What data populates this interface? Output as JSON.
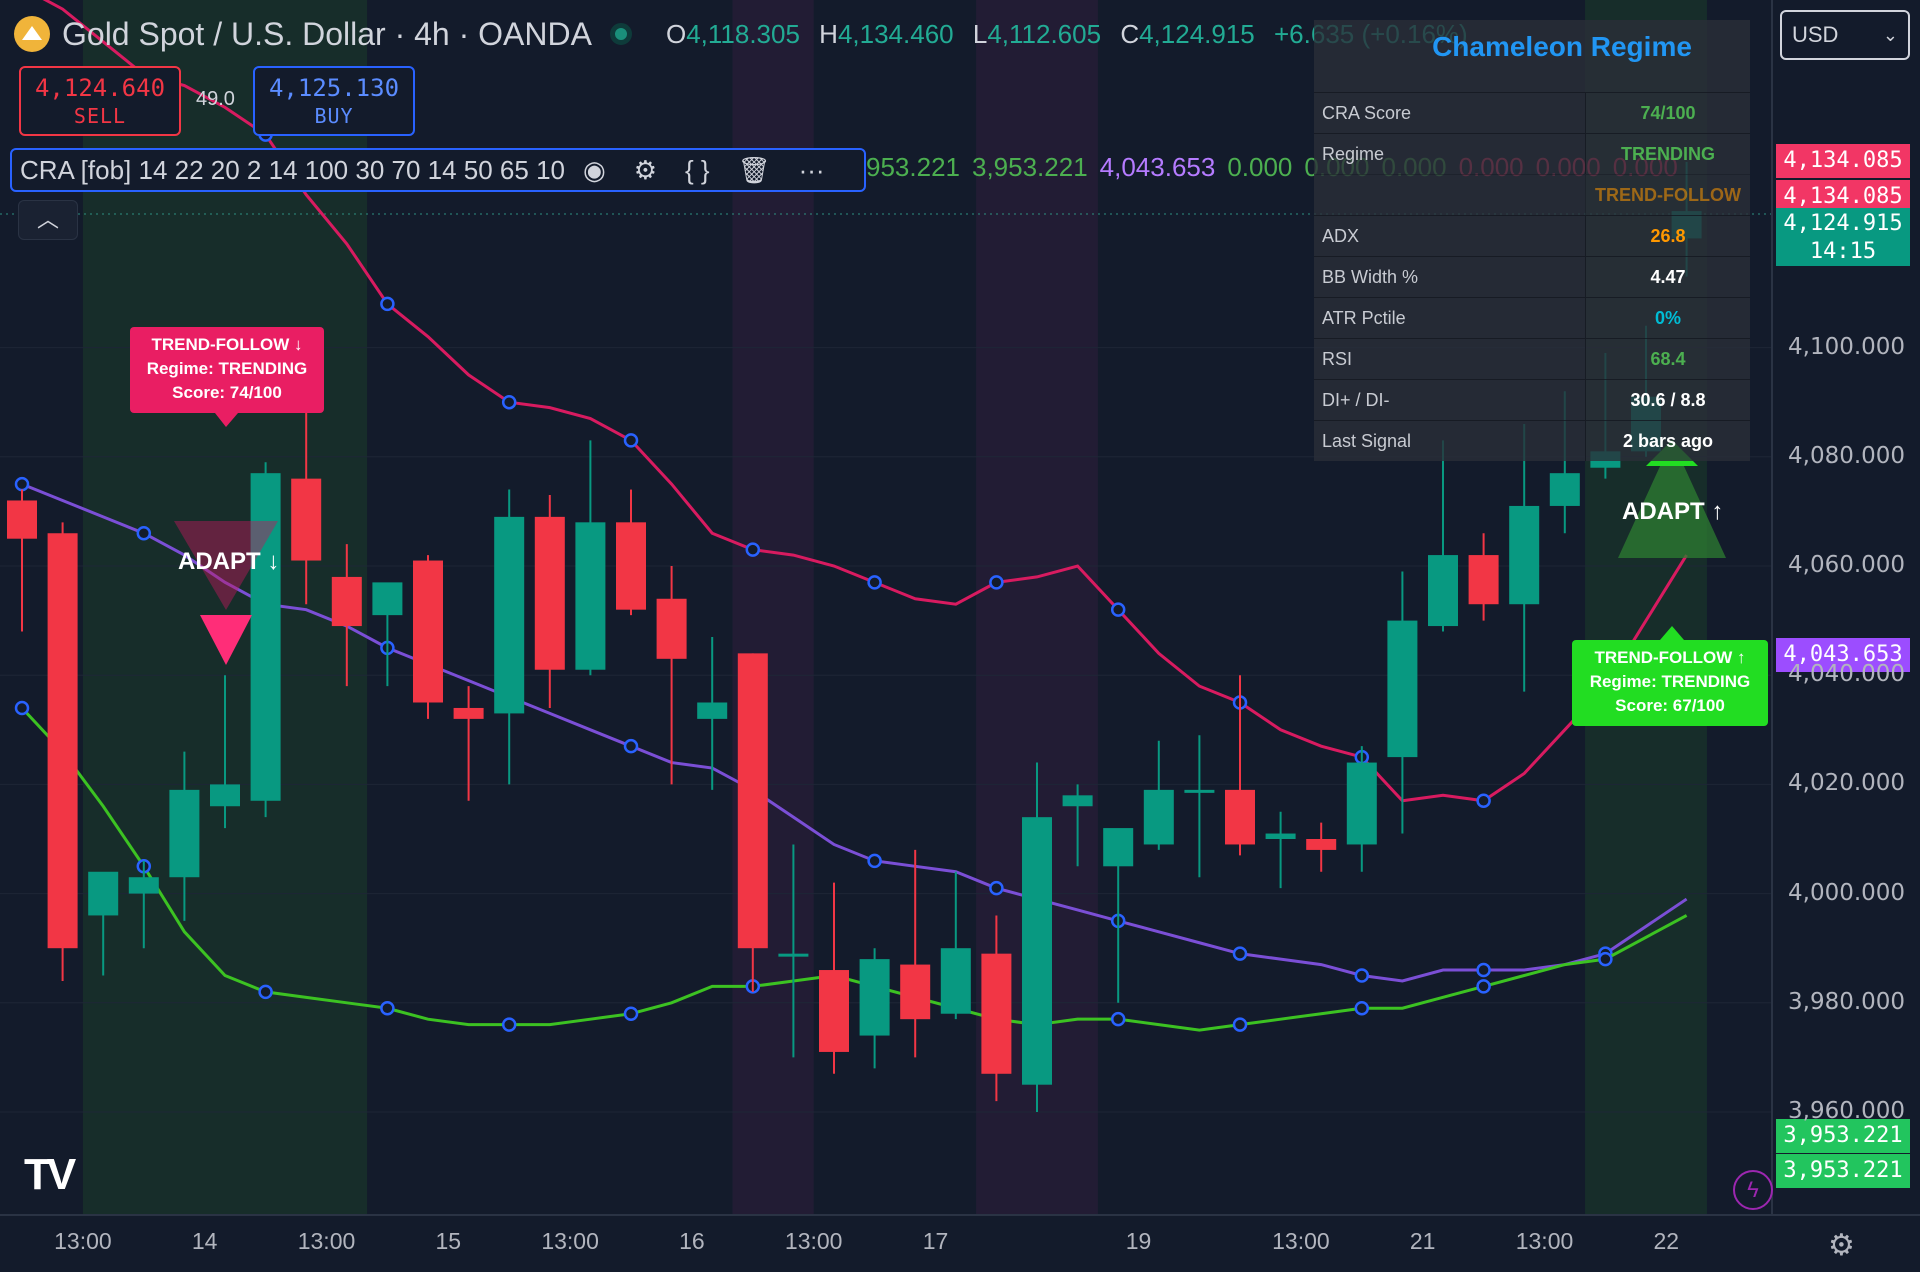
{
  "header": {
    "symbol": "Gold Spot / U.S. Dollar · 4h · OANDA",
    "o_label": "O",
    "o": "4,118.305",
    "h_label": "H",
    "h": "4,134.460",
    "l_label": "L",
    "l": "4,112.605",
    "c_label": "C",
    "c": "4,124.915",
    "change": "+6.635 (+0.16%)"
  },
  "trade": {
    "sell_price": "4,124.640",
    "sell_label": "SELL",
    "spread": "49.0",
    "buy_price": "4,125.130",
    "buy_label": "BUY"
  },
  "indicator": {
    "name": "CRA [fob] 14 22 20 2 14 100 30 70 14 50 65 10",
    "values": [
      {
        "text": "953.221",
        "color": "#4caf50"
      },
      {
        "text": "3,953.221",
        "color": "#4caf50"
      },
      {
        "text": "4,043.653",
        "color": "#b57bff"
      },
      {
        "text": "0.000",
        "color": "#4caf50"
      },
      {
        "text": "0.000",
        "color": "#4caf50"
      },
      {
        "text": "0.000",
        "color": "#4caf50"
      },
      {
        "text": "0.000",
        "color": "#f23665"
      },
      {
        "text": "0.000",
        "color": "#f23665"
      },
      {
        "text": "0.000",
        "color": "#f23665"
      }
    ],
    "eye_icon": "eye-icon",
    "settings_icon": "settings-icon",
    "code_icon": "code-icon",
    "delete_icon": "trash-icon",
    "more_icon": "more-icon"
  },
  "currency": "USD",
  "panel": {
    "title": "Chameleon Regime",
    "rows": [
      {
        "key": "CRA Score",
        "value": "74/100",
        "color": "#4caf50"
      },
      {
        "key": "Regime",
        "value": "TRENDING",
        "color": "#4caf50"
      },
      {
        "key": "",
        "value": "TREND-FOLLOW",
        "color": "#ff9800"
      },
      {
        "key": "ADX",
        "value": "26.8",
        "color": "#ff9800"
      },
      {
        "key": "BB Width %",
        "value": "4.47",
        "color": "#ffffff"
      },
      {
        "key": "ATR Pctile",
        "value": "0%",
        "color": "#00bcd4"
      },
      {
        "key": "RSI",
        "value": "68.4",
        "color": "#4caf50"
      },
      {
        "key": "DI+ / DI-",
        "value": "30.6 / 8.8",
        "color": "#ffffff"
      },
      {
        "key": "Last Signal",
        "value": "2 bars ago",
        "color": "#ffffff"
      }
    ]
  },
  "labels": {
    "sell_signal": {
      "line1": "TREND-FOLLOW ↓",
      "line2": "Regime: TRENDING",
      "line3": "Score: 74/100"
    },
    "buy_signal": {
      "line1": "TREND-FOLLOW ↑",
      "line2": "Regime: TRENDING",
      "line3": "Score: 67/100"
    },
    "adapt_down": "ADAPT ↓",
    "adapt_up": "ADAPT ↑"
  },
  "price_tags": [
    {
      "text": "4,134.085",
      "color": "#f23665",
      "price": 4134.085
    },
    {
      "text": "4,134.085",
      "color": "#f23665",
      "price": 4127.6
    },
    {
      "text": "4,124.915",
      "color": "#089981",
      "price": 4121.0,
      "sub": "14:15"
    },
    {
      "text": "4,043.653",
      "color": "#9c4dff",
      "price": 4043.653
    },
    {
      "text": "3,953.221",
      "color": "#22c55e",
      "price": 3955.6
    },
    {
      "text": "3,953.221",
      "color": "#22c55e",
      "price": 3949.2
    }
  ],
  "chart_data": {
    "type": "candlestick",
    "symbol": "XAUUSD",
    "timeframe": "4h",
    "ylim": [
      3937,
      4157
    ],
    "y_ticks": [
      4100,
      4080,
      4060,
      4040,
      4020,
      4000,
      3980,
      3960
    ],
    "y_tick_labels": [
      "4,100.000",
      "4,080.000",
      "4,060.000",
      "4,040.000",
      "4,020.000",
      "4,000.000",
      "3,980.000",
      "3,960.000"
    ],
    "x_ticks": [
      {
        "label": "13:00",
        "bar": 1.5
      },
      {
        "label": "14",
        "bar": 4.5
      },
      {
        "label": "13:00",
        "bar": 7.5
      },
      {
        "label": "15",
        "bar": 10.5
      },
      {
        "label": "13:00",
        "bar": 13.5
      },
      {
        "label": "16",
        "bar": 16.5
      },
      {
        "label": "13:00",
        "bar": 19.5
      },
      {
        "label": "17",
        "bar": 22.5
      },
      {
        "label": "19",
        "bar": 27.5
      },
      {
        "label": "13:00",
        "bar": 31.5
      },
      {
        "label": "21",
        "bar": 34.5
      },
      {
        "label": "13:00",
        "bar": 37.5
      },
      {
        "label": "22",
        "bar": 40.5
      }
    ],
    "candles": [
      [
        4072,
        4074,
        4048,
        4065
      ],
      [
        4066,
        4068,
        3984,
        3990
      ],
      [
        3996,
        4000,
        3985,
        4004
      ],
      [
        4000,
        4006,
        3990,
        4003
      ],
      [
        4003,
        4026,
        3995,
        4019
      ],
      [
        4016,
        4040,
        4012,
        4020
      ],
      [
        4017,
        4079,
        4014,
        4077
      ],
      [
        4076,
        4090,
        4053,
        4061
      ],
      [
        4058,
        4064,
        4038,
        4049
      ],
      [
        4051,
        4055,
        4038,
        4057
      ],
      [
        4061,
        4062,
        4032,
        4035
      ],
      [
        4034,
        4038,
        4017,
        4032
      ],
      [
        4033,
        4074,
        4020,
        4069
      ],
      [
        4069,
        4073,
        4034,
        4041
      ],
      [
        4041,
        4083,
        4040,
        4068
      ],
      [
        4068,
        4074,
        4051,
        4052
      ],
      [
        4054,
        4060,
        4020,
        4043
      ],
      [
        4032,
        4047,
        4019,
        4035
      ],
      [
        4044,
        4044,
        3982,
        3990
      ],
      [
        3989,
        4009,
        3970,
        3989
      ],
      [
        3986,
        4002,
        3967,
        3971
      ],
      [
        3974,
        3990,
        3968,
        3988
      ],
      [
        3987,
        4008,
        3970,
        3977
      ],
      [
        3978,
        4004,
        3977,
        3990
      ],
      [
        3989,
        3996,
        3962,
        3967
      ],
      [
        3965,
        4024,
        3960,
        4014
      ],
      [
        4016,
        4020,
        4005,
        4018
      ],
      [
        4005,
        4011,
        3980,
        4012
      ],
      [
        4009,
        4028,
        4008,
        4019
      ],
      [
        4019,
        4029,
        4003,
        4019
      ],
      [
        4019,
        4040,
        4007,
        4009
      ],
      [
        4010,
        4015,
        4001,
        4011
      ],
      [
        4010,
        4013,
        4004,
        4008
      ],
      [
        4009,
        4027,
        4004,
        4024
      ],
      [
        4025,
        4059,
        4011,
        4050
      ],
      [
        4049,
        4083,
        4048,
        4062
      ],
      [
        4062,
        4066,
        4050,
        4053
      ],
      [
        4053,
        4086,
        4037,
        4071
      ],
      [
        4071,
        4092,
        4066,
        4077
      ],
      [
        4078,
        4099,
        4076,
        4081
      ],
      [
        4081,
        4104,
        4080,
        4091
      ],
      [
        4120,
        4134,
        4113,
        4125
      ]
    ],
    "upper_band": [
      4166,
      4162,
      4156,
      4150,
      4148,
      4144,
      4139,
      4128,
      4119,
      4108,
      4102,
      4095,
      4090,
      4089,
      4087,
      4083,
      4075,
      4066,
      4063,
      4062,
      4060,
      4057,
      4054,
      4053,
      4057,
      4058,
      4060,
      4052,
      4044,
      4038,
      4035,
      4030,
      4027,
      4025,
      4017,
      4018,
      4017,
      4022,
      4030,
      4038,
      4050,
      4062
    ],
    "middle_band": [
      4075,
      4072,
      4069,
      4066,
      4062,
      4057,
      4053,
      4052,
      4049,
      4045,
      4042,
      4039,
      4036,
      4033,
      4030,
      4027,
      4024,
      4023,
      4019,
      4014,
      4009,
      4006,
      4005,
      4004,
      4001,
      3999,
      3997,
      3995,
      3993,
      3991,
      3989,
      3988,
      3987,
      3985,
      3984,
      3986,
      3986,
      3986,
      3987,
      3989,
      3994,
      3999
    ],
    "lower_band": [
      4034,
      4026,
      4016,
      4005,
      3993,
      3985,
      3982,
      3981,
      3980,
      3979,
      3977,
      3976,
      3976,
      3976,
      3977,
      3978,
      3980,
      3983,
      3983,
      3984,
      3985,
      3983,
      3981,
      3979,
      3977,
      3976,
      3977,
      3977,
      3976,
      3975,
      3976,
      3977,
      3978,
      3979,
      3979,
      3981,
      3983,
      3985,
      3987,
      3988,
      3992,
      3996
    ],
    "regime_bg": [
      {
        "from": 2,
        "to": 8,
        "color": "#1a3a2a"
      },
      {
        "from": 18,
        "to": 19,
        "color": "#2d1e3a"
      },
      {
        "from": 24,
        "to": 26,
        "color": "#2d1e3a"
      },
      {
        "from": 39,
        "to": 41,
        "color": "#1a3a2a"
      }
    ]
  }
}
